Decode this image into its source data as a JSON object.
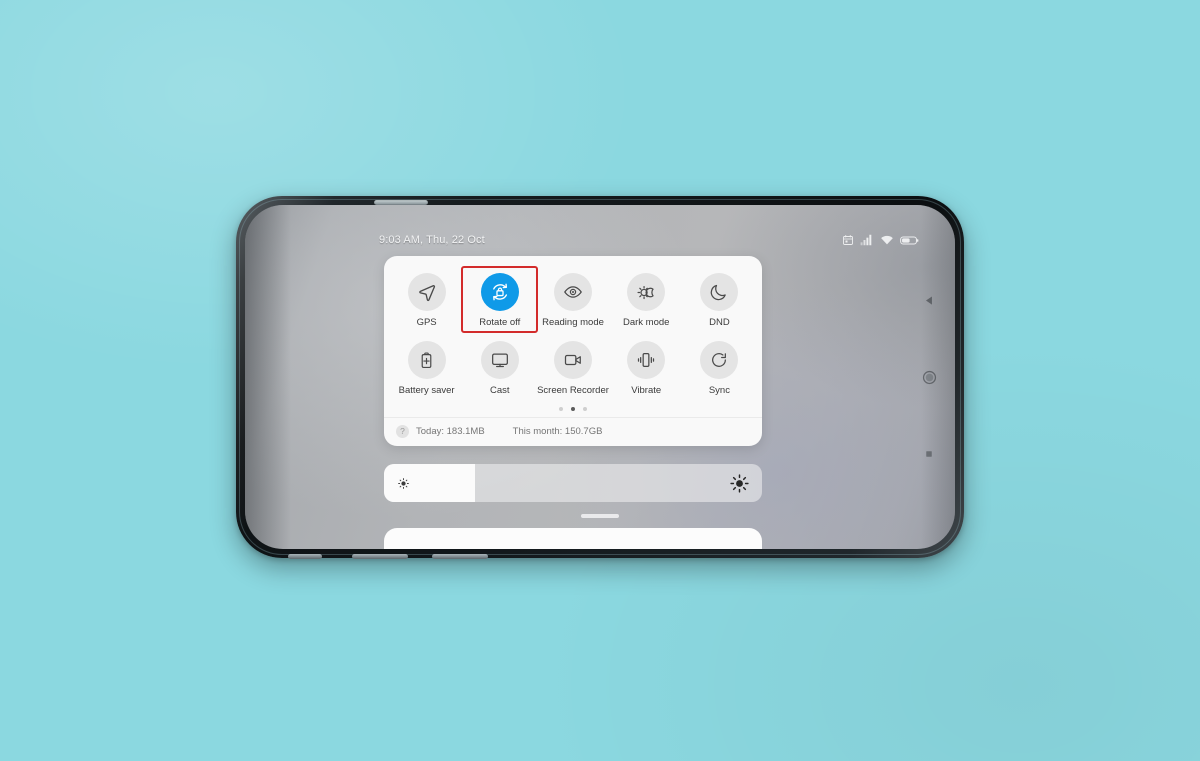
{
  "background": {
    "color": "#8bd8e0"
  },
  "device": {
    "name": "smartphone",
    "orientation": "landscape",
    "frame_color": "#12181b"
  },
  "status_bar": {
    "clock": "9:03 AM, Thu, 22 Oct",
    "icons": [
      {
        "name": "alarm-icon",
        "label": "Alarm"
      },
      {
        "name": "signal-bars-icon",
        "label": "Signal"
      },
      {
        "name": "wifi-icon",
        "label": "Wi-Fi"
      },
      {
        "name": "battery-icon",
        "label": "Battery"
      }
    ]
  },
  "quick_settings": {
    "accent_color": "#0f9ae8",
    "highlight_color": "#d32b2b",
    "tiles": [
      {
        "label": "GPS",
        "icon": "location-arrow-icon",
        "active": false,
        "highlighted": false
      },
      {
        "label": "Rotate off",
        "icon": "rotate-lock-icon",
        "active": true,
        "highlighted": true
      },
      {
        "label": "Reading mode",
        "icon": "eye-icon",
        "active": false,
        "highlighted": false
      },
      {
        "label": "Dark mode",
        "icon": "sun-moon-icon",
        "active": false,
        "highlighted": false
      },
      {
        "label": "DND",
        "icon": "moon-icon",
        "active": false,
        "highlighted": false
      },
      {
        "label": "Battery saver",
        "icon": "battery-plus-icon",
        "active": false,
        "highlighted": false
      },
      {
        "label": "Cast",
        "icon": "monitor-cast-icon",
        "active": false,
        "highlighted": false
      },
      {
        "label": "Screen Recorder",
        "icon": "video-camera-icon",
        "active": false,
        "highlighted": false
      },
      {
        "label": "Vibrate",
        "icon": "vibrate-icon",
        "active": false,
        "highlighted": false
      },
      {
        "label": "Sync",
        "icon": "sync-circle-icon",
        "active": false,
        "highlighted": false
      }
    ],
    "pager": {
      "count": 3,
      "active_index": 1
    },
    "data_usage": {
      "help_glyph": "?",
      "today": "Today: 183.1MB",
      "month": "This month: 150.7GB"
    }
  },
  "brightness": {
    "name": "brightness-slider",
    "value_percent": 24,
    "low_icon": "brightness-low-icon",
    "high_icon": "brightness-high-icon"
  },
  "nav_bar": {
    "buttons": [
      {
        "name": "back-button",
        "icon": "triangle-back-icon"
      },
      {
        "name": "home-button",
        "icon": "circle-home-icon"
      },
      {
        "name": "recents-button",
        "icon": "square-recents-icon"
      }
    ]
  }
}
